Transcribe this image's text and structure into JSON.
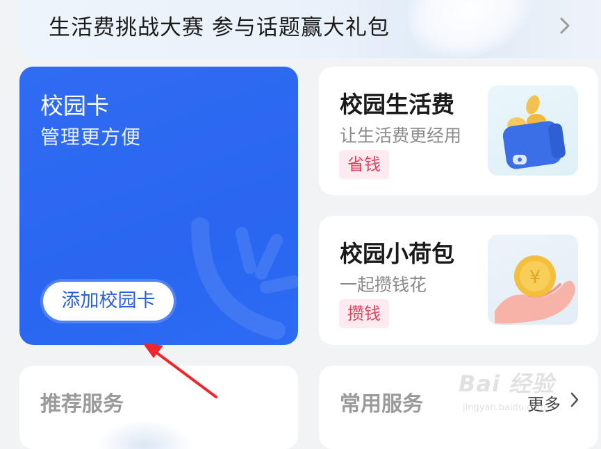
{
  "banner": {
    "title": "生活费挑战大赛 参与话题赢大礼包",
    "chevron_icon": "chevron-right-icon"
  },
  "campus_card": {
    "title": "校园卡",
    "subtitle": "管理更方便",
    "button_label": "添加校园卡",
    "accent_color": "#2a66f0"
  },
  "living_expense": {
    "title": "校园生活费",
    "subtitle": "让生活费更经用",
    "tag": "省钱",
    "thumb_icon": "wallet-coins-icon"
  },
  "lotus_purse": {
    "title": "校园小荷包",
    "subtitle": "一起攒钱花",
    "tag": "攒钱",
    "thumb_icon": "hand-coin-icon"
  },
  "recommended": {
    "title": "推荐服务"
  },
  "common": {
    "title": "常用服务",
    "more_label": "更多"
  },
  "watermark": {
    "main": "Bai 经验",
    "sub": "jingyan.baidu.com"
  },
  "annotation": {
    "arrow_color": "#f0262a"
  }
}
